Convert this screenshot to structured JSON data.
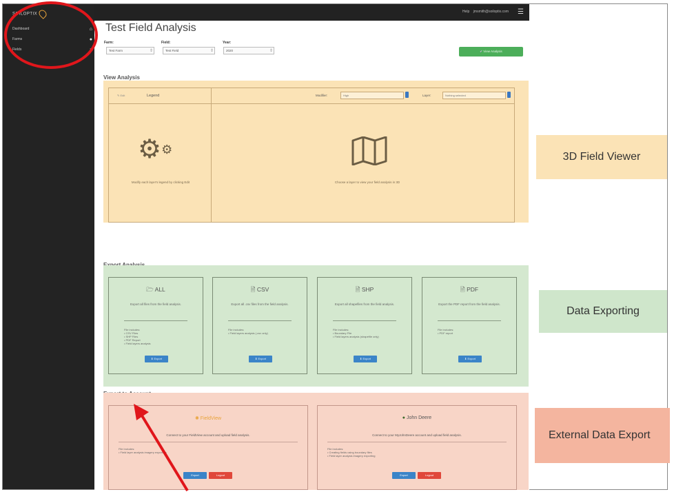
{
  "app": {
    "logo_text": "SOILOPTIX"
  },
  "sidebar": {
    "items": [
      {
        "label": "Dashboard",
        "icon": "home-icon"
      },
      {
        "label": "Farms",
        "icon": "globe-icon"
      },
      {
        "label": "Fields",
        "icon": "pin-icon"
      }
    ]
  },
  "topbar": {
    "help": "Help",
    "user_email": "jmsmith@soiloptix.com",
    "menu_icon": "hamburger-icon"
  },
  "page": {
    "title": "Test Field Analysis",
    "farm_label": "Farm:",
    "farm_value": "Test Farm",
    "field_label": "Field:",
    "field_value": "Test Field",
    "year_label": "Year:",
    "year_value": "2020",
    "view_button": "View Analysis"
  },
  "view_analysis": {
    "title": "View Analysis",
    "edit_label": "Edit",
    "legend_label": "Legend",
    "modifier_label": "Modifier:",
    "modifier_value": "High",
    "layer_label": "Layer:",
    "layer_value": "Nothing selected",
    "legend_hint": "Modify each layer's legend by clicking Edit",
    "map_hint": "Choose a layer to view your field analysis in 3D"
  },
  "export_analysis": {
    "title": "Export Analysis",
    "cards": [
      {
        "title": "ALL",
        "icon": "folder-icon",
        "desc": "Export all files from the field analysis.",
        "includes": [
          "File includes:",
          "• CSV Files",
          "• SHP Files",
          "• PDF Report",
          "• Field layers analysis"
        ],
        "button": "Export"
      },
      {
        "title": "CSV",
        "icon": "file-icon",
        "desc": "Export all .csv files from the field analysis.",
        "includes": [
          "File includes:",
          "• Field layers analysis (.csv only)"
        ],
        "button": "Export"
      },
      {
        "title": "SHP",
        "icon": "file-icon",
        "desc": "Export all shapefiles from the field analysis.",
        "includes": [
          "File includes:",
          "• Boundary File",
          "• Field layers analysis (shapefile only)"
        ],
        "button": "Export"
      },
      {
        "title": "PDF",
        "icon": "file-icon",
        "desc": "Export the PDF report from the field analysis.",
        "includes": [
          "File includes:",
          "• PDF report"
        ],
        "button": "Export"
      }
    ]
  },
  "export_account": {
    "title": "Export to Account",
    "cards": [
      {
        "title": "FieldView",
        "icon": "fieldview-icon",
        "desc": "Connect to your FieldView account and upload field analysis.",
        "includes": [
          "File includes:",
          "• Field layer analysis imagery exporting"
        ],
        "export": "Export",
        "logout": "Logout"
      },
      {
        "title": "John Deere",
        "icon": "deere-icon",
        "desc": "Connect to your MyJohnDeere account and upload field analysis.",
        "includes": [
          "File includes:",
          "• Creating fields using boundary files",
          "• Field layer analysis imagery exporting"
        ],
        "export": "Export",
        "logout": "Logout"
      }
    ]
  },
  "callouts": {
    "viewer": "3D Field Viewer",
    "exporting": "Data Exporting",
    "external": "External Data Export"
  },
  "colors": {
    "viewer_bg": "#fbe3b6",
    "export_bg": "#d4e8cf",
    "external_bg": "#f8d5c7",
    "annotation_red": "#e0161b",
    "button_blue": "#3b84c8",
    "button_green": "#4cae5a"
  }
}
